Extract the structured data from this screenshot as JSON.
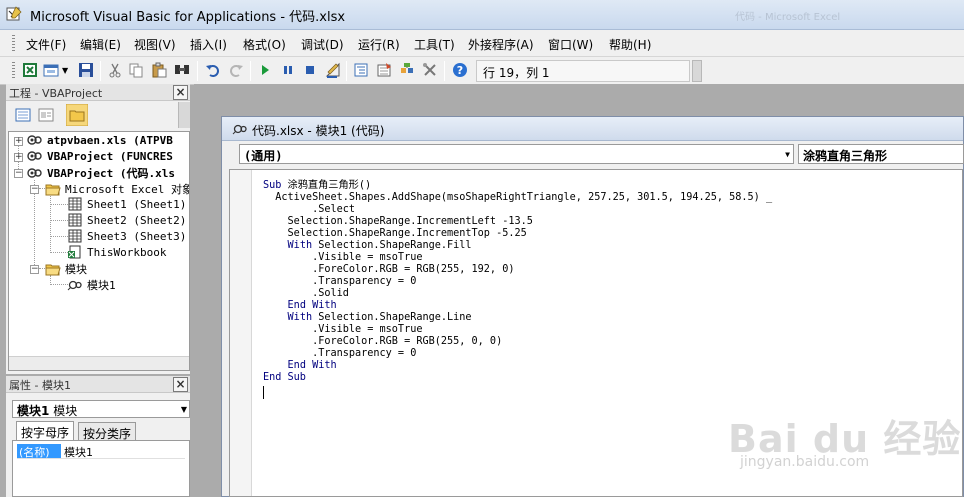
{
  "window": {
    "title": "Microsoft Visual Basic for Applications - 代码.xlsx",
    "ghost_title": "代码 - Microsoft Excel"
  },
  "menu": [
    "文件(F)",
    "编辑(E)",
    "视图(V)",
    "插入(I)",
    "格式(O)",
    "调试(D)",
    "运行(R)",
    "工具(T)",
    "外接程序(A)",
    "窗口(W)",
    "帮助(H)"
  ],
  "toolbar": {
    "position_status": "行 19，列 1",
    "icons": [
      "excel-icon",
      "insert-userform-icon",
      "save-icon",
      "cut-icon",
      "copy-icon",
      "paste-icon",
      "find-icon",
      "undo-icon",
      "redo-icon",
      "run-icon",
      "break-icon",
      "reset-icon",
      "design-mode-icon",
      "project-explorer-icon",
      "properties-window-icon",
      "object-browser-icon",
      "toolbox-icon",
      "help-icon"
    ]
  },
  "project_pane": {
    "title": "工程 - VBAProject",
    "tree": [
      {
        "label": "atpvbaen.xls (ATPVB",
        "bold": true
      },
      {
        "label": "VBAProject (FUNCRES",
        "bold": true
      },
      {
        "label": "VBAProject (代码.xls",
        "bold": true
      },
      {
        "label": "Microsoft Excel 对象",
        "bold": false
      },
      {
        "label": "Sheet1 (Sheet1)",
        "bold": false
      },
      {
        "label": "Sheet2 (Sheet2)",
        "bold": false
      },
      {
        "label": "Sheet3 (Sheet3)",
        "bold": false
      },
      {
        "label": "ThisWorkbook",
        "bold": false
      },
      {
        "label": "模块",
        "bold": false
      },
      {
        "label": "模块1",
        "bold": false
      }
    ]
  },
  "properties_pane": {
    "title": "属性 - 模块1",
    "object_name": "模块1",
    "object_type": "模块",
    "tabs": [
      "按字母序",
      "按分类序"
    ],
    "rows": [
      {
        "key": "(名称)",
        "value": "模块1"
      }
    ]
  },
  "code_window": {
    "title": "代码.xlsx - 模块1 (代码)",
    "object_combo": "(通用)",
    "procedure_combo": "涂鸦直角三角形",
    "lines": [
      "Sub 涂鸦直角三角形()",
      "  ActiveSheet.Shapes.AddShape(msoShapeRightTriangle, 257.25, 301.5, 194.25, 58.5) _",
      "        .Select",
      "    Selection.ShapeRange.IncrementLeft -13.5",
      "    Selection.ShapeRange.IncrementTop -5.25",
      "    With Selection.ShapeRange.Fill",
      "        .Visible = msoTrue",
      "        .ForeColor.RGB = RGB(255, 192, 0)",
      "        .Transparency = 0",
      "        .Solid",
      "    End With",
      "    With Selection.ShapeRange.Line",
      "        .Visible = msoTrue",
      "        .ForeColor.RGB = RGB(255, 0, 0)",
      "        .Transparency = 0",
      "    End With",
      "End Sub"
    ]
  },
  "watermark": {
    "brand": "Bai du 经验",
    "sub": "jingyan.baidu.com"
  },
  "colors": {
    "keyword": "#00007f",
    "selection": "#3399ff",
    "folder": "#f3c74a"
  }
}
